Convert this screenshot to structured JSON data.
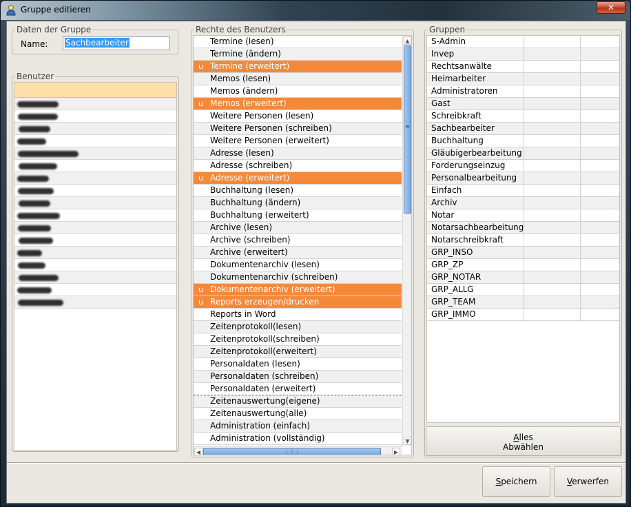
{
  "window": {
    "title": "Gruppe editieren",
    "close_label": "✕"
  },
  "group_data": {
    "legend": "Daten der Gruppe",
    "name_label": "Name:",
    "name_value": "Sachbearbeiter"
  },
  "users": {
    "legend": "Benutzer",
    "redacted_widths": [
      60,
      58,
      46,
      42,
      88,
      56,
      46,
      52,
      46,
      62,
      48,
      50,
      36,
      40,
      58,
      50,
      66
    ]
  },
  "rights": {
    "legend": "Rechte des Benutzers",
    "items": [
      {
        "label": "Termine (lesen)",
        "mark": "",
        "highlight": false
      },
      {
        "label": "Termine (ändern)",
        "mark": "",
        "highlight": false
      },
      {
        "label": "Termine (erweitert)",
        "mark": "u",
        "highlight": true
      },
      {
        "label": "Memos (lesen)",
        "mark": "",
        "highlight": false
      },
      {
        "label": "Memos (ändern)",
        "mark": "",
        "highlight": false
      },
      {
        "label": "Memos (erweitert)",
        "mark": "u",
        "highlight": true
      },
      {
        "label": "Weitere Personen (lesen)",
        "mark": "",
        "highlight": false
      },
      {
        "label": "Weitere Personen (schreiben)",
        "mark": "",
        "highlight": false
      },
      {
        "label": "Weitere Personen (erweitert)",
        "mark": "",
        "highlight": false
      },
      {
        "label": "Adresse (lesen)",
        "mark": "",
        "highlight": false
      },
      {
        "label": "Adresse (schreiben)",
        "mark": "",
        "highlight": false
      },
      {
        "label": "Adresse (erweitert)",
        "mark": "u",
        "highlight": true
      },
      {
        "label": "Buchhaltung (lesen)",
        "mark": "",
        "highlight": false
      },
      {
        "label": "Buchhaltung (ändern)",
        "mark": "",
        "highlight": false
      },
      {
        "label": "Buchhaltung (erweitert)",
        "mark": "",
        "highlight": false
      },
      {
        "label": "Archive (lesen)",
        "mark": "",
        "highlight": false
      },
      {
        "label": "Archive (schreiben)",
        "mark": "",
        "highlight": false
      },
      {
        "label": "Archive (erweitert)",
        "mark": "",
        "highlight": false
      },
      {
        "label": "Dokumentenarchiv (lesen)",
        "mark": "",
        "highlight": false
      },
      {
        "label": "Dokumentenarchiv (schreiben)",
        "mark": "",
        "highlight": false
      },
      {
        "label": "Dokumentenarchiv (erweitert)",
        "mark": "u",
        "highlight": true
      },
      {
        "label": "Reports erzeugen/drucken",
        "mark": "u",
        "highlight": true
      },
      {
        "label": "Reports in Word",
        "mark": "",
        "highlight": false
      },
      {
        "label": "Zeitenprotokoll(lesen)",
        "mark": "",
        "highlight": false
      },
      {
        "label": "Zeitenprotokoll(schreiben)",
        "mark": "",
        "highlight": false
      },
      {
        "label": "Zeitenprotokoll(erweitert)",
        "mark": "",
        "highlight": false
      },
      {
        "label": "Personaldaten (lesen)",
        "mark": "",
        "highlight": false
      },
      {
        "label": "Personaldaten (schreiben)",
        "mark": "",
        "highlight": false
      },
      {
        "label": "Personaldaten (erweitert)",
        "mark": "",
        "highlight": false
      },
      {
        "label": "Zeitenauswertung(eigene)",
        "mark": "",
        "highlight": false
      },
      {
        "label": "Zeitenauswertung(alle)",
        "mark": "",
        "highlight": false
      },
      {
        "label": "Administration (einfach)",
        "mark": "",
        "highlight": false
      },
      {
        "label": "Administration (vollständig)",
        "mark": "",
        "highlight": false
      }
    ]
  },
  "groups": {
    "legend": "Gruppen",
    "items": [
      "S-Admin",
      "Invep",
      "Rechtsanwälte",
      "Heimarbeiter",
      "Administratoren",
      "Gast",
      "Schreibkraft",
      "Sachbearbeiter",
      "Buchhaltung",
      "Gläubigerbearbeitung",
      "Forderungseinzug",
      "Personalbearbeitung",
      "Einfach",
      "Archiv",
      "Notar",
      "Notarsachbearbeitung",
      "Notarschreibkraft",
      "GRP_INSO",
      "GRP_ZP",
      "GRP_NOTAR",
      "GRP_ALLG",
      "GRP_TEAM",
      "GRP_IMMO"
    ],
    "select_all_line1": "Alles",
    "select_all_line2": "Abwählen"
  },
  "footer": {
    "save_label": "Speichern",
    "discard_label": "Verwerfen"
  },
  "icons": {
    "app": "user-icon",
    "scroll_up": "arrow-up-icon",
    "scroll_down": "arrow-down-icon",
    "scroll_left": "arrow-left-icon",
    "scroll_right": "arrow-right-icon"
  },
  "colors": {
    "highlight": "#f5893a",
    "header_band": "#fedfa8",
    "scroll_thumb": "#7aa8de"
  }
}
